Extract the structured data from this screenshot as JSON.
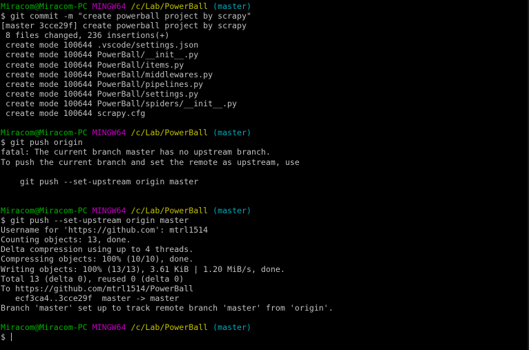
{
  "prompts": [
    {
      "user": "Miracom@Miracom-PC",
      "env": "MINGW64",
      "path": "/c/Lab/PowerBall",
      "branch": "(master)"
    },
    {
      "user": "Miracom@Miracom-PC",
      "env": "MINGW64",
      "path": "/c/Lab/PowerBall",
      "branch": "(master)"
    },
    {
      "user": "Miracom@Miracom-PC",
      "env": "MINGW64",
      "path": "/c/Lab/PowerBall",
      "branch": "(master)"
    },
    {
      "user": "Miracom@Miracom-PC",
      "env": "MINGW64",
      "path": "/c/Lab/PowerBall",
      "branch": "(master)"
    }
  ],
  "block1": {
    "command": "$ git commit -m \"create powerball project by scrapy\"",
    "output": [
      "[master 3cce29f] create powerball project by scrapy",
      " 8 files changed, 236 insertions(+)",
      " create mode 100644 .vscode/settings.json",
      " create mode 100644 PowerBall/__init__.py",
      " create mode 100644 PowerBall/items.py",
      " create mode 100644 PowerBall/middlewares.py",
      " create mode 100644 PowerBall/pipelines.py",
      " create mode 100644 PowerBall/settings.py",
      " create mode 100644 PowerBall/spiders/__init__.py",
      " create mode 100644 scrapy.cfg"
    ]
  },
  "block2": {
    "command": "$ git push origin",
    "output": [
      "fatal: The current branch master has no upstream branch.",
      "To push the current branch and set the remote as upstream, use",
      "",
      "    git push --set-upstream origin master",
      "",
      ""
    ]
  },
  "block3": {
    "command": "$ git push --set-upstream origin master",
    "output": [
      "Username for 'https://github.com': mtrl1514",
      "Counting objects: 13, done.",
      "Delta compression using up to 4 threads.",
      "Compressing objects: 100% (10/10), done.",
      "Writing objects: 100% (13/13), 3.61 KiB | 1.20 MiB/s, done.",
      "Total 13 (delta 0), reused 0 (delta 0)",
      "To https://github.com/mtrl1514/PowerBall",
      "   ecf3ca4..3cce29f  master -> master",
      "Branch 'master' set up to track remote branch 'master' from 'origin'."
    ]
  },
  "final_prompt_symbol": "$ "
}
